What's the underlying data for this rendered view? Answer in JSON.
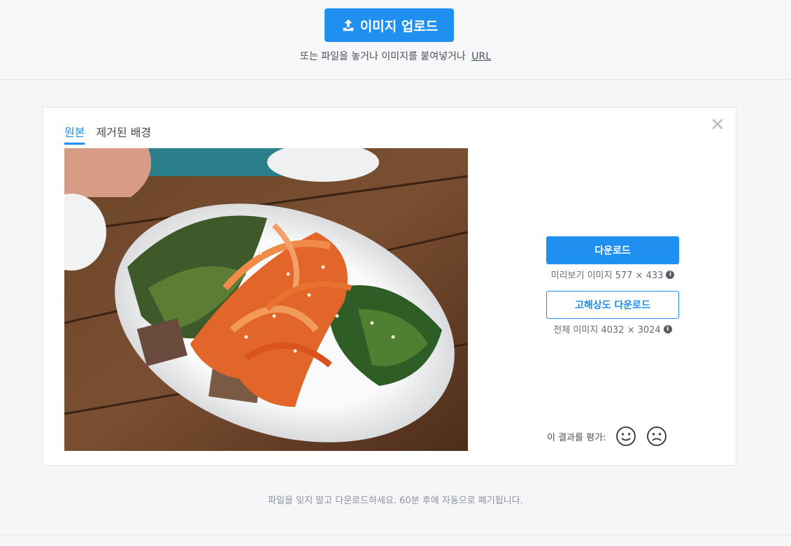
{
  "upload": {
    "button_label": "이미지 업로드",
    "hint_text": "또는 파일을 놓거나 이미지를 붙여넣거나",
    "url_link": "URL"
  },
  "card": {
    "tabs": [
      {
        "label": "원본",
        "active": true
      },
      {
        "label": "제거된 배경",
        "active": false
      }
    ],
    "close_glyph": "✕",
    "download": {
      "label": "다운로드",
      "preview_info": "미리보기 이미지 577 × 433"
    },
    "hd_download": {
      "label": "고해상도 다운로드",
      "full_info": "전체 이미지 4032 × 3024"
    },
    "rating": {
      "label": "이 결과를 평가:",
      "positive_icon": "smile-face-icon",
      "negative_icon": "frown-face-icon"
    }
  },
  "footer_note": "파일을 잊지 말고 다운로드하세요. 60분 후에 자동으로 폐기됩니다.",
  "colors": {
    "accent": "#1f8ff0",
    "background": "#f5f6f8"
  }
}
